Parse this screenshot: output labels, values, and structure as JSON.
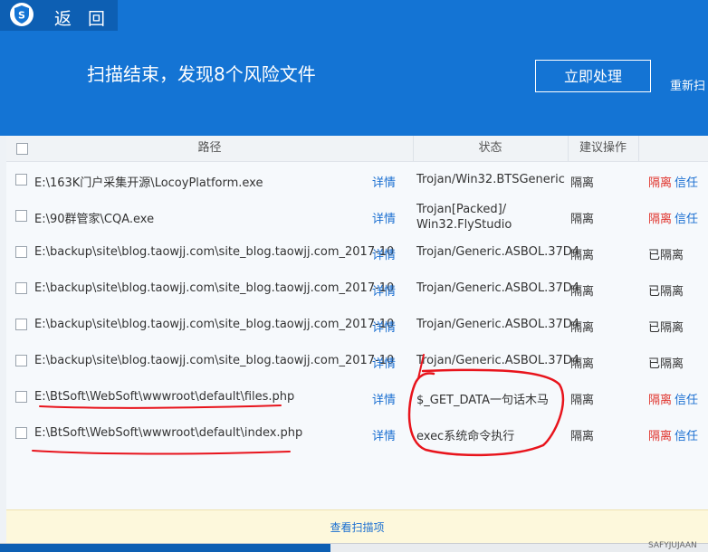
{
  "header": {
    "back_label": "返 回",
    "summary": "扫描结束，发现8个风险文件",
    "process_button": "立即处理",
    "rescan_link": "重新扫",
    "colors": {
      "header_bg": "#1474d4",
      "titlebar_bg": "#0d5fb3",
      "link": "#1b6fd1",
      "danger": "#e0332c"
    }
  },
  "table": {
    "columns": {
      "path": "路径",
      "status": "状态",
      "action": "建议操作"
    },
    "detail_label": "详情",
    "isolate_col_label": "隔离",
    "action_isolate": "隔离",
    "action_trust": "信任",
    "action_isolated": "已隔离",
    "rows": [
      {
        "path": "E:\\163K门户采集开源\\LocoyPlatform.exe",
        "status": "Trojan/Win32.BTSGeneric",
        "status2": ""
      },
      {
        "path": "E:\\90群管家\\CQA.exe",
        "status": "Trojan[Packed]/",
        "status2": "Win32.FlyStudio"
      },
      {
        "path": "E:\\backup\\site\\blog.taowjj.com\\site_blog.taowjj.com_2017-10",
        "status": "Trojan/Generic.ASBOL.37D4",
        "status2": ""
      },
      {
        "path": "E:\\backup\\site\\blog.taowjj.com\\site_blog.taowjj.com_2017-10",
        "status": "Trojan/Generic.ASBOL.37D4",
        "status2": ""
      },
      {
        "path": "E:\\backup\\site\\blog.taowjj.com\\site_blog.taowjj.com_2017-10",
        "status": "Trojan/Generic.ASBOL.37D4",
        "status2": ""
      },
      {
        "path": "E:\\backup\\site\\blog.taowjj.com\\site_blog.taowjj.com_2017-10",
        "status": "Trojan/Generic.ASBOL.37D4",
        "status2": ""
      },
      {
        "path": "E:\\BtSoft\\WebSoft\\wwwroot\\default\\files.php",
        "status": "$_GET_DATA一句话木马",
        "status2": ""
      },
      {
        "path": "E:\\BtSoft\\WebSoft\\wwwroot\\default\\index.php",
        "status": "exec系统命令执行",
        "status2": ""
      }
    ]
  },
  "footer": {
    "view_items": "查看扫描项"
  },
  "taskbar": {
    "text": "SAFYJUJAAN"
  }
}
